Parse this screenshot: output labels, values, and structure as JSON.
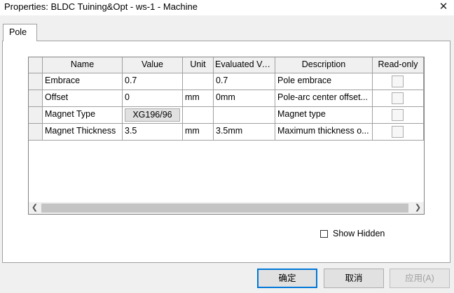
{
  "window": {
    "title": "Properties: BLDC Tuining&Opt - ws-1 - Machine",
    "close_glyph": "✕"
  },
  "tabs": [
    {
      "label": "Pole"
    }
  ],
  "grid": {
    "columns": [
      "Name",
      "Value",
      "Unit",
      "Evaluated Va...",
      "Description",
      "Read-only"
    ],
    "rows": [
      {
        "name": "Embrace",
        "value": "0.7",
        "unit": "",
        "evaluated": "0.7",
        "description": "Pole embrace",
        "read_only": false
      },
      {
        "name": "Offset",
        "value": "0",
        "unit": "mm",
        "evaluated": "0mm",
        "description": "Pole-arc center offset...",
        "read_only": false
      },
      {
        "name": "Magnet Type",
        "value": "XG196/96",
        "unit": "",
        "evaluated": "",
        "description": "Magnet type",
        "read_only": false
      },
      {
        "name": "Magnet Thickness",
        "value": "3.5",
        "unit": "mm",
        "evaluated": "3.5mm",
        "description": "Maximum thickness o...",
        "read_only": false
      }
    ]
  },
  "show_hidden": {
    "label": "Show Hidden",
    "checked": false
  },
  "buttons": {
    "ok": "确定",
    "cancel": "取消",
    "apply": "应用(A)"
  }
}
